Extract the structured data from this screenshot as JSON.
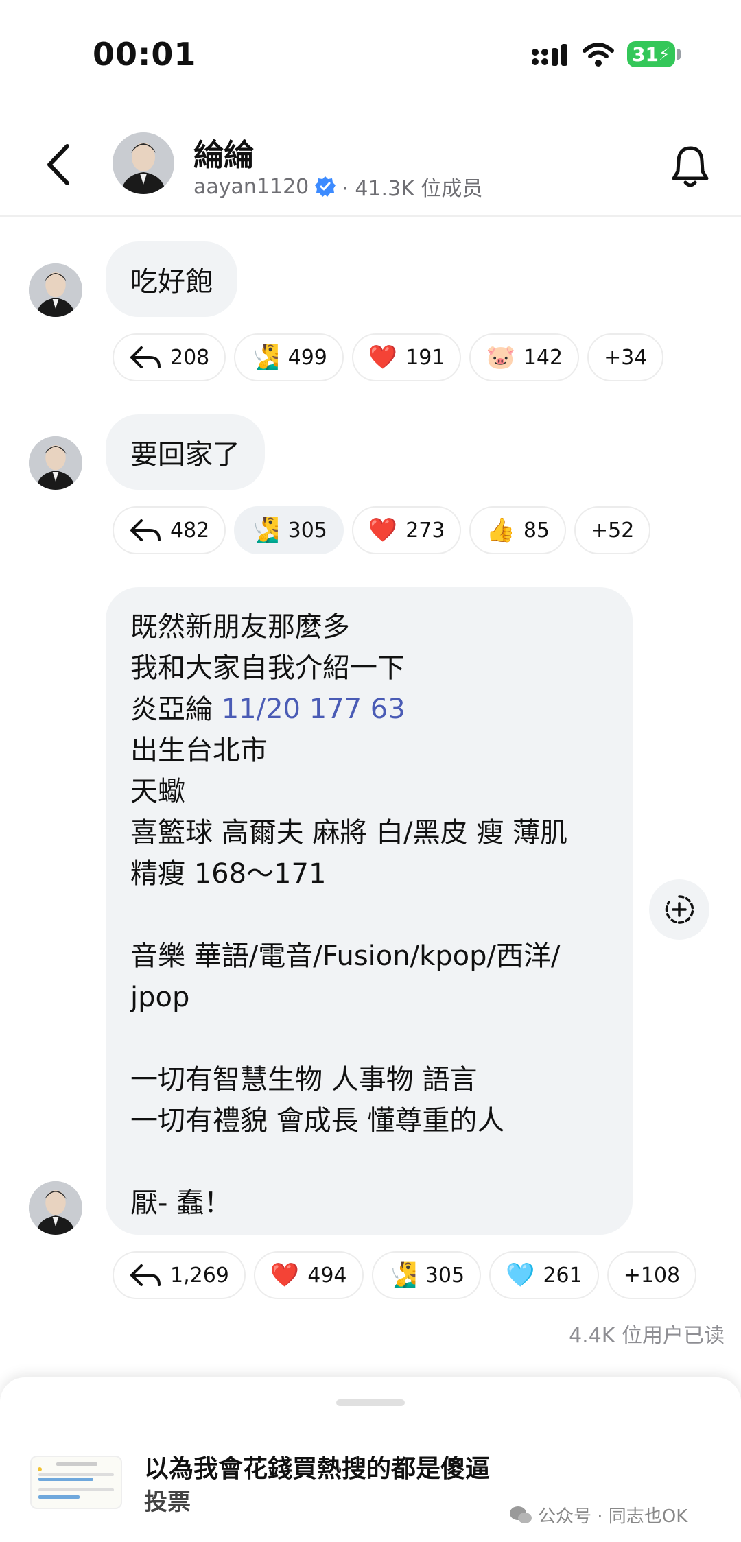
{
  "status_bar": {
    "time": "00:01",
    "battery": "31"
  },
  "header": {
    "title": "綸綸",
    "handle": "aayan1120",
    "members": "· 41.3K 位成员"
  },
  "messages": [
    {
      "text": "吃好飽",
      "reactions": [
        {
          "icon": "reply-icon",
          "count": "208"
        },
        {
          "emoji": "🧏‍♂️",
          "count": "499"
        },
        {
          "emoji": "❤️",
          "count": "191"
        },
        {
          "emoji": "🐷",
          "count": "142"
        },
        {
          "count": "+34"
        }
      ]
    },
    {
      "text": "要回家了",
      "reactions": [
        {
          "icon": "reply-icon",
          "count": "482"
        },
        {
          "emoji": "🧏‍♂️",
          "count": "305"
        },
        {
          "emoji": "❤️",
          "count": "273"
        },
        {
          "emoji": "👍",
          "count": "85"
        },
        {
          "count": "+52"
        }
      ]
    },
    {
      "lines": {
        "l1": "既然新朋友那麼多",
        "l2": "我和大家自我介紹一下",
        "l3_a": "炎亞綸 ",
        "l3_b": "11/20 177 63",
        "l4": "出生台北市",
        "l5": "天蠍",
        "l6": "喜籃球 高爾夫 麻將 白/黑皮 瘦 薄肌",
        "l7": "精瘦 168～171",
        "l8": "音樂 華語/電音/Fusion/kpop/西洋/",
        "l9": "jpop",
        "l10": "一切有智慧生物 人事物 語言",
        "l11": "一切有禮貌 會成長 懂尊重的人",
        "l12": "厭- 蠢！"
      },
      "reactions": [
        {
          "icon": "reply-icon",
          "count": "1,269"
        },
        {
          "emoji": "❤️",
          "count": "494"
        },
        {
          "emoji": "🧏‍♂️",
          "count": "305"
        },
        {
          "emoji": "🩵",
          "count": "261"
        },
        {
          "count": "+108"
        }
      ]
    }
  ],
  "readers": "4.4K 位用户已读",
  "sheet": {
    "title": "以為我會花錢買熱搜的都是傻逼",
    "subtitle": "投票"
  },
  "watermark": "公众号 · 同志也OK"
}
